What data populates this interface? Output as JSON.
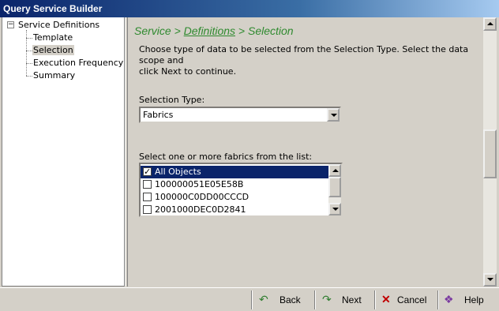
{
  "window": {
    "title": "Query Service Builder"
  },
  "tree": {
    "root": "Service Definitions",
    "expander": "−",
    "items": [
      "Template",
      "Selection",
      "Execution Frequency",
      "Summary"
    ],
    "selected": "Selection"
  },
  "breadcrumb": {
    "part1": "Service",
    "sep1": ">",
    "part2": "Definitions",
    "sep2": ">",
    "part3": "Selection"
  },
  "instructions": {
    "line1": "Choose type of data to be selected from the Selection Type. Select the data scope and",
    "line2": "click Next to continue."
  },
  "selection_type": {
    "label": "Selection Type:",
    "value": "Fabrics"
  },
  "fabrics": {
    "label": "Select one or more fabrics from the list:",
    "items": [
      {
        "text": "All Objects",
        "checked": true,
        "selected": true
      },
      {
        "text": "100000051E05E58B",
        "checked": false,
        "selected": false
      },
      {
        "text": "100000C0DD00CCCD",
        "checked": false,
        "selected": false
      },
      {
        "text": "2001000DEC0D2841",
        "checked": false,
        "selected": false
      }
    ]
  },
  "buttons": {
    "back": "Back",
    "next": "Next",
    "cancel": "Cancel",
    "help": "Help"
  },
  "colors": {
    "breadcrumb": "#2f8a2f",
    "selection": "#0a246a",
    "panel": "#d4d0c8"
  }
}
